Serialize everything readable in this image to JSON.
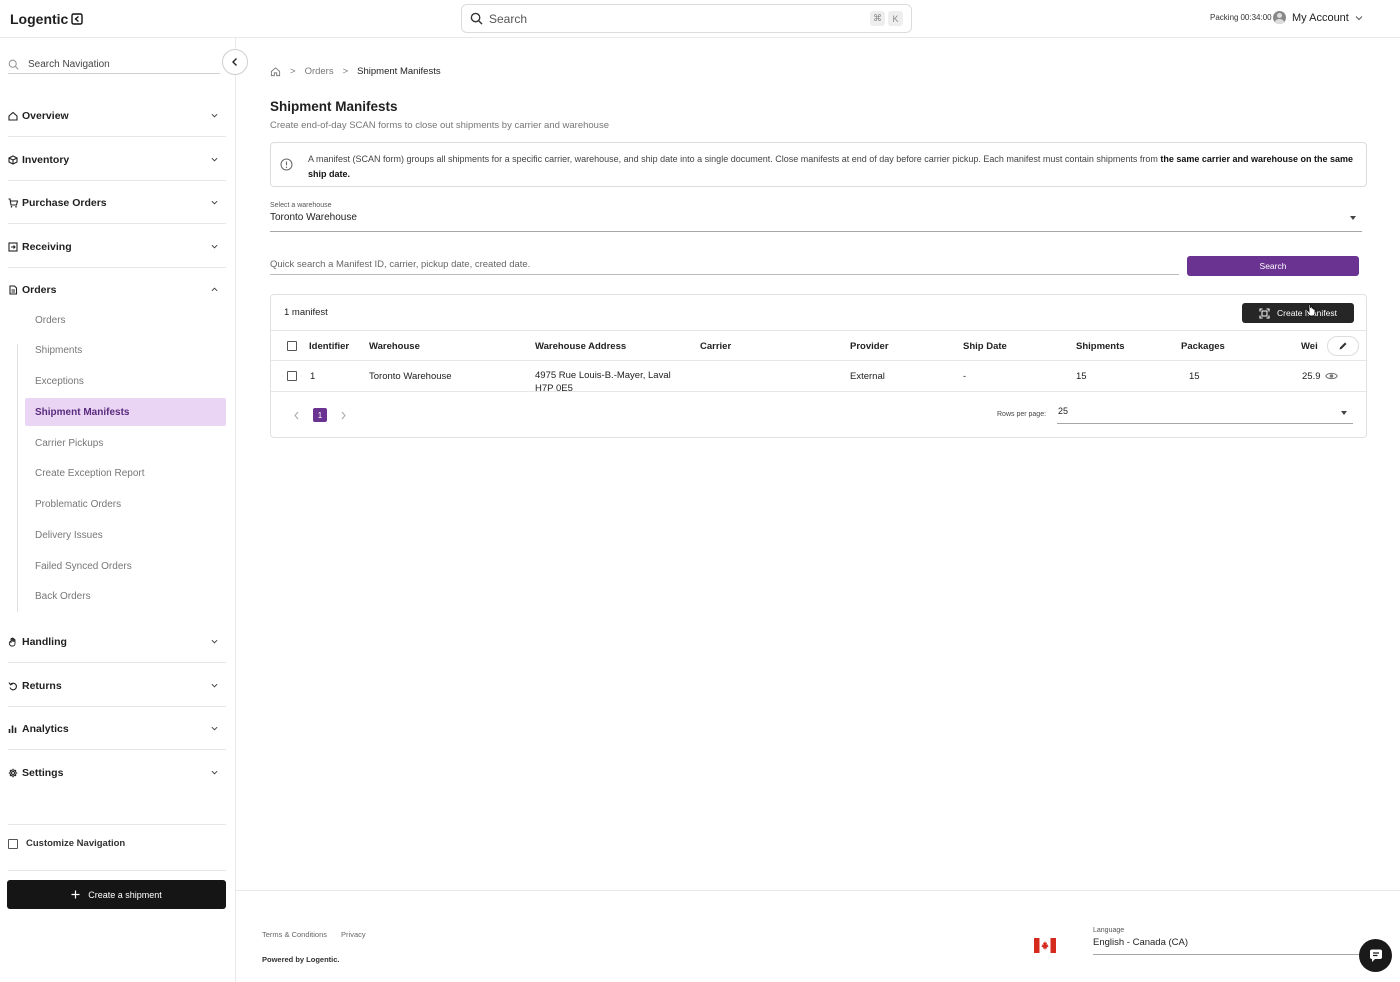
{
  "app": {
    "logo_text": "Logentic"
  },
  "topbar": {
    "search_placeholder": "Search",
    "shortcut_cmd": "⌘",
    "shortcut_key": "K",
    "packing_label": "Packing",
    "packing_timer": "00:34:00",
    "account_label": "My Account"
  },
  "sidebar": {
    "search_placeholder": "Search Navigation",
    "groups": {
      "overview": "Overview",
      "inventory": "Inventory",
      "purchase_orders": "Purchase Orders",
      "receiving": "Receiving",
      "orders": "Orders",
      "handling": "Handling",
      "returns": "Returns",
      "analytics": "Analytics",
      "settings": "Settings"
    },
    "orders_items": [
      "Orders",
      "Shipments",
      "Exceptions",
      "Shipment Manifests",
      "Carrier Pickups",
      "Create Exception Report",
      "Problematic Orders",
      "Delivery Issues",
      "Failed Synced Orders",
      "Back Orders"
    ],
    "active_item": "Shipment Manifests",
    "customize_label": "Customize Navigation",
    "create_shipment_label": "Create a shipment"
  },
  "breadcrumb": {
    "level1": "Orders",
    "current": "Shipment Manifests"
  },
  "page": {
    "title": "Shipment Manifests",
    "subtitle": "Create end-of-day SCAN forms to close out shipments by carrier and warehouse"
  },
  "info": {
    "text": "A manifest (SCAN form) groups all shipments for a specific carrier, warehouse, and ship date into a single document. Close manifests at end of day before carrier pickup. Each manifest must contain shipments from ",
    "bold": "the same carrier and warehouse on the same ship date."
  },
  "warehouse_select": {
    "label": "Select a warehouse",
    "value": "Toronto Warehouse"
  },
  "quick_search": {
    "placeholder": "Quick search a Manifest ID, carrier, pickup date, created date.",
    "button": "Search"
  },
  "table": {
    "count_label": "1 manifest",
    "create_button": "Create Manifest",
    "columns": [
      "Identifier",
      "Warehouse",
      "Warehouse Address",
      "Carrier",
      "Provider",
      "Ship Date",
      "Shipments",
      "Packages",
      "Wei"
    ],
    "rows": [
      {
        "identifier": "1",
        "warehouse": "Toronto Warehouse",
        "address": "4975 Rue Louis-B.-Mayer, Laval",
        "address2": "H7P 0E5",
        "carrier": "",
        "provider": "External",
        "ship_date": "-",
        "shipments": "15",
        "packages": "15",
        "weight": "25.9"
      }
    ],
    "pagination": {
      "current_page": "1",
      "rows_per_page_label": "Rows per page:",
      "rows_per_page_value": "25"
    }
  },
  "footer": {
    "terms": "Terms & Conditions",
    "privacy": "Privacy",
    "powered": "Powered by Logentic.",
    "language_label": "Language",
    "language_value": "English - Canada (CA)"
  },
  "colors": {
    "accent": "#6b3391",
    "active_nav_bg": "#ead6f4",
    "dark_button": "#151515",
    "flag_red": "#d52b1e"
  },
  "icons": {
    "search": "search-icon",
    "home": "home-icon",
    "info": "info-icon",
    "edit": "pencil-icon",
    "view": "eye-icon",
    "flag": "canada-flag-icon",
    "chat": "chat-icon"
  }
}
